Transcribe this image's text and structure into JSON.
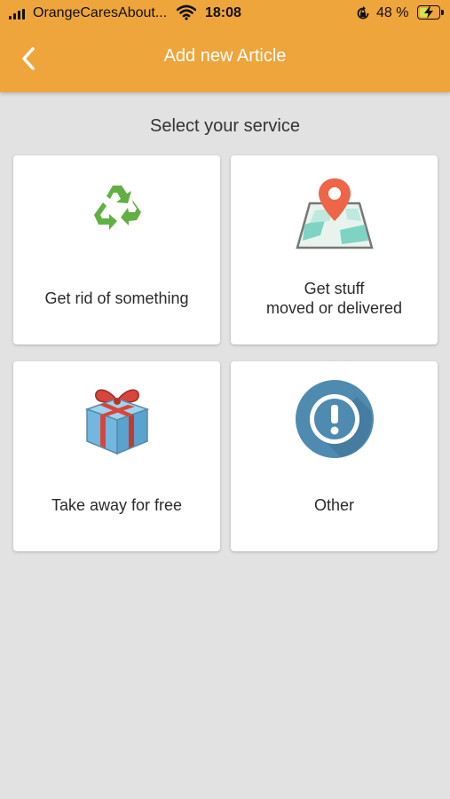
{
  "status_bar": {
    "carrier": "OrangeCaresAbout...",
    "time": "18:08",
    "battery_percent": "48 %",
    "battery_level": 0.48
  },
  "header": {
    "title": "Add new Article",
    "accent_color": "#eea53b"
  },
  "main": {
    "subtitle": "Select your service",
    "services": [
      {
        "label": "Get rid of something",
        "icon": "recycle-icon"
      },
      {
        "label_line1": "Get stuff",
        "label_line2": "moved or delivered",
        "icon": "map-pin-icon"
      },
      {
        "label": "Take away for free",
        "icon": "gift-icon"
      },
      {
        "label": "Other",
        "icon": "exclamation-icon"
      }
    ]
  }
}
